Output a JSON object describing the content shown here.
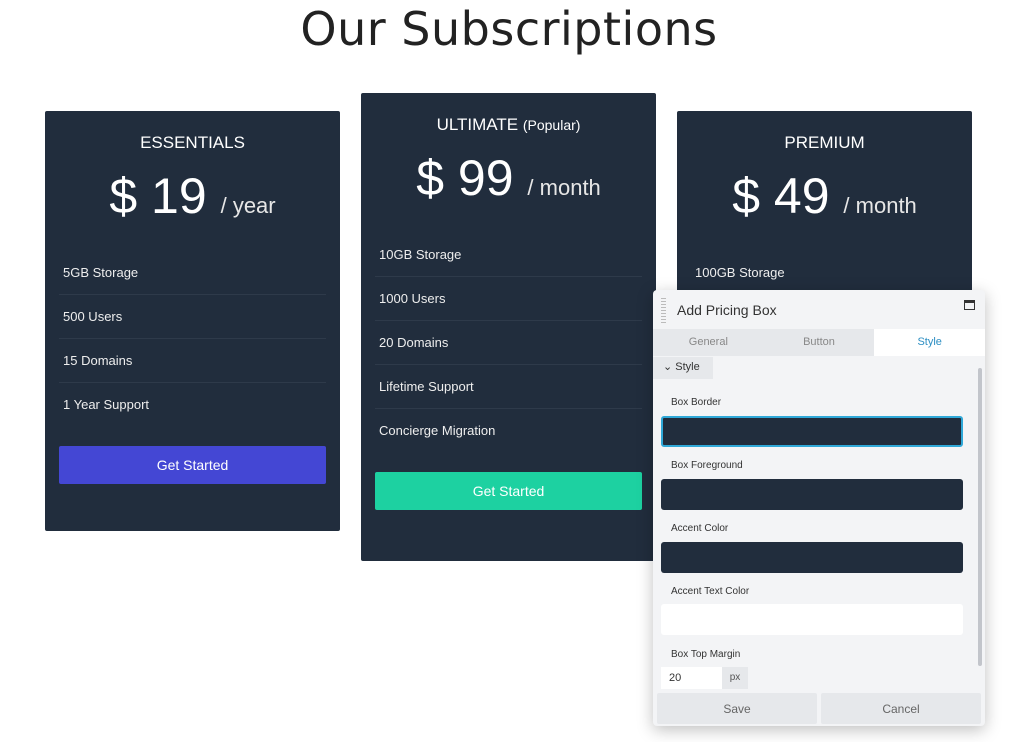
{
  "title": "Our Subscriptions",
  "plans": [
    {
      "name": "ESSENTIALS",
      "tag": "",
      "price": "$ 19",
      "period": "/ year",
      "features": [
        "5GB Storage",
        "500 Users",
        "15 Domains",
        "1 Year Support"
      ],
      "button": "Get Started",
      "button_color": "#4447d4"
    },
    {
      "name": "ULTIMATE",
      "tag": "(Popular)",
      "price": "$ 99",
      "period": "/ month",
      "features": [
        "10GB Storage",
        "1000 Users",
        "20 Domains",
        "Lifetime Support",
        "Concierge Migration"
      ],
      "button": "Get Started",
      "button_color": "#1dd1a1"
    },
    {
      "name": "PREMIUM",
      "tag": "",
      "price": "$ 49",
      "period": "/ month",
      "features": [
        "100GB Storage"
      ]
    }
  ],
  "panel": {
    "title": "Add Pricing Box",
    "tabs": [
      "General",
      "Button",
      "Style"
    ],
    "active_tab": "Style",
    "section": "Style",
    "fields": [
      {
        "label": "Box Border",
        "color": "#212d3d"
      },
      {
        "label": "Box Foreground",
        "color": "#212d3d"
      },
      {
        "label": "Accent Color",
        "color": "#212d3d"
      },
      {
        "label": "Accent Text Color",
        "color": "#ffffff"
      }
    ],
    "margin_label": "Box Top Margin",
    "margin_value": "20",
    "margin_unit": "px",
    "save": "Save",
    "cancel": "Cancel"
  }
}
